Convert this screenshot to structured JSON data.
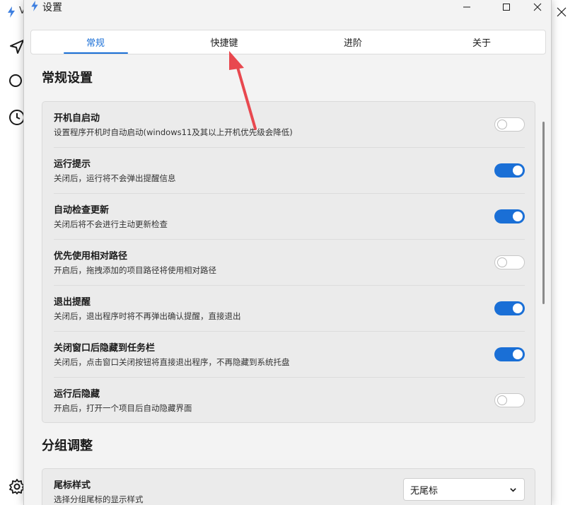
{
  "background_window": {
    "title_partial": "V",
    "nav_icons": [
      "send-icon",
      "search-icon",
      "clock-icon",
      "gear-icon"
    ]
  },
  "dialog": {
    "title": "设置",
    "window_buttons": [
      "minimize-icon",
      "maximize-icon",
      "close-icon"
    ],
    "accent_color": "#1a6fd6"
  },
  "tabs": [
    {
      "label": "常规",
      "active": true
    },
    {
      "label": "快捷键",
      "active": false
    },
    {
      "label": "进阶",
      "active": false
    },
    {
      "label": "关于",
      "active": false
    }
  ],
  "sections": {
    "general": {
      "title": "常规设置",
      "items": [
        {
          "name": "开机自启动",
          "desc": "设置程序开机时自动启动(windows11及其以上开机优先级会降低)",
          "enabled": false
        },
        {
          "name": "运行提示",
          "desc": "关闭后，运行将不会弹出提醒信息",
          "enabled": true
        },
        {
          "name": "自动检查更新",
          "desc": "关闭后将不会进行主动更新检查",
          "enabled": true
        },
        {
          "name": "优先使用相对路径",
          "desc": "开启后，拖拽添加的项目路径将使用相对路径",
          "enabled": false
        },
        {
          "name": "退出提醒",
          "desc": "关闭后，退出程序时将不再弹出确认提醒，直接退出",
          "enabled": true
        },
        {
          "name": "关闭窗口后隐藏到任务栏",
          "desc": "关闭后，点击窗口关闭按钮将直接退出程序，不再隐藏到系统托盘",
          "enabled": true
        },
        {
          "name": "运行后隐藏",
          "desc": "开启后，打开一个项目后自动隐藏界面",
          "enabled": false
        }
      ]
    },
    "group": {
      "title": "分组调整",
      "items": [
        {
          "name": "尾标样式",
          "desc": "选择分组尾标的显示样式",
          "select_value": "无尾标"
        }
      ]
    }
  },
  "annotation": {
    "color": "#e8484f"
  }
}
